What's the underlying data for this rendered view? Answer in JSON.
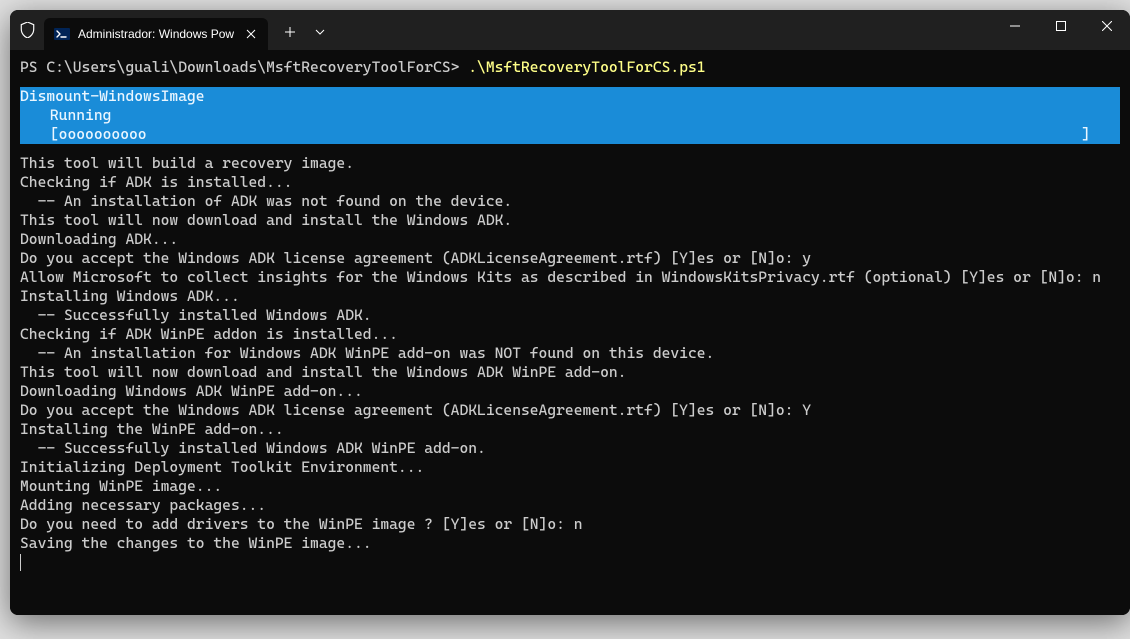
{
  "window": {
    "tab_title": "Administrador: Windows Pow",
    "shield_icon": "shield-icon",
    "ps_icon": "powershell-icon"
  },
  "prompt": {
    "prefix": "PS C:\\Users\\guali\\Downloads\\MsftRecoveryToolForCS> ",
    "command": ".\\MsftRecoveryToolForCS.ps1"
  },
  "progress": {
    "title": "Dismount-WindowsImage",
    "status": "Running",
    "bar_open": "[",
    "bar_fill": "oooooooooo",
    "bar_close": "]"
  },
  "output": [
    "This tool will build a recovery image.",
    "Checking if ADK is installed...",
    "  -- An installation of ADK was not found on the device.",
    "This tool will now download and install the Windows ADK.",
    "Downloading ADK...",
    "Do you accept the Windows ADK license agreement (ADKLicenseAgreement.rtf) [Y]es or [N]o: y",
    "Allow Microsoft to collect insights for the Windows Kits as described in WindowsKitsPrivacy.rtf (optional) [Y]es or [N]o: n",
    "Installing Windows ADK...",
    "  -- Successfully installed Windows ADK.",
    "Checking if ADK WinPE addon is installed...",
    "  -- An installation for Windows ADK WinPE add-on was NOT found on this device.",
    "This tool will now download and install the Windows ADK WinPE add-on.",
    "Downloading Windows ADK WinPE add-on...",
    "Do you accept the Windows ADK license agreement (ADKLicenseAgreement.rtf) [Y]es or [N]o: Y",
    "Installing the WinPE add-on...",
    "  -- Successfully installed Windows ADK WinPE add-on.",
    "Initializing Deployment Toolkit Environment...",
    "Mounting WinPE image...",
    "Adding necessary packages...",
    "Do you need to add drivers to the WinPE image ? [Y]es or [N]o: n",
    "Saving the changes to the WinPE image..."
  ]
}
